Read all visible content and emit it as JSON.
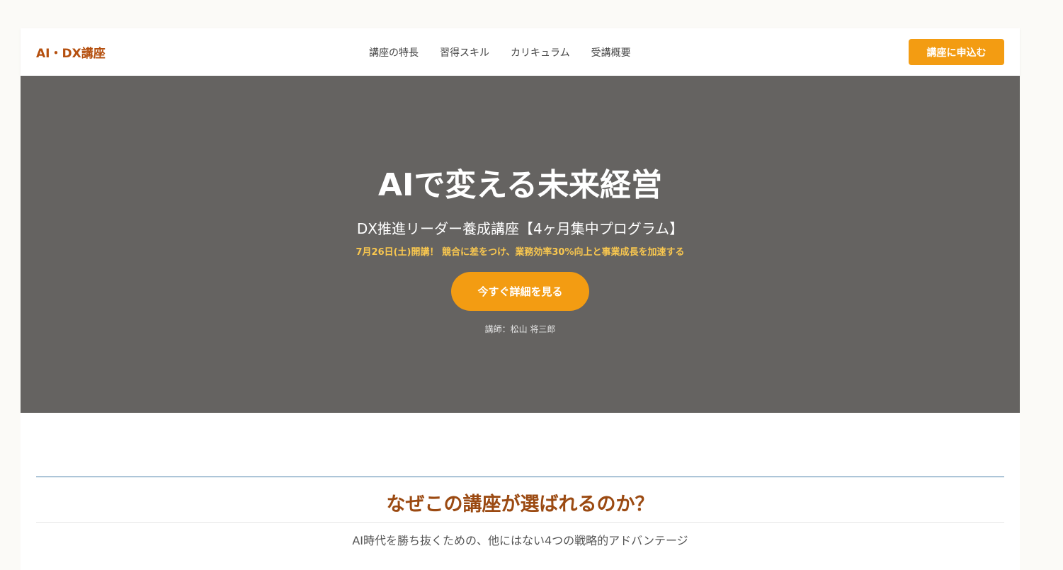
{
  "header": {
    "logo": "AI・DX講座",
    "nav": [
      "講座の特長",
      "習得スキル",
      "カリキュラム",
      "受講概要"
    ],
    "cta_label": "講座に申込む"
  },
  "hero": {
    "title": "AIで変える未来経営",
    "subtitle": "DX推進リーダー養成講座【4ヶ月集中プログラム】",
    "tagline": "7月26日(土)開講！ 競合に差をつけ、業務効率30%向上と事業成長を加速する",
    "button_label": "今すぐ詳細を見る",
    "instructor": "講師：松山 将三郎"
  },
  "features": {
    "title": "なぜこの講座が選ばれるのか？",
    "subtitle": "AI時代を勝ち抜くための、他にはない4つの戦略的アドバンテージ"
  },
  "colors": {
    "accent": "#f39c12",
    "brand": "#b5500f",
    "hero_bg": "#656361",
    "highlight": "#f9c74f"
  }
}
